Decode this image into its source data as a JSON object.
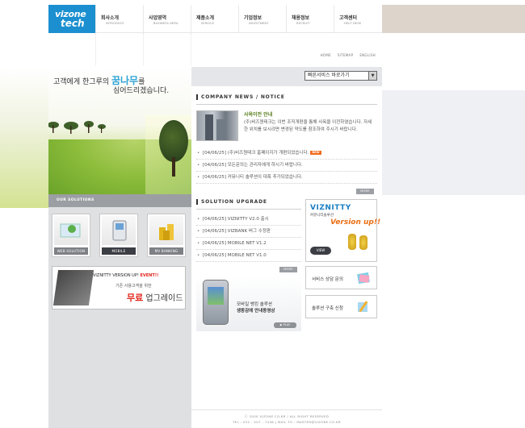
{
  "brand": {
    "line1": "vizone",
    "line2": "tech"
  },
  "nav": [
    {
      "ko": "회사소개",
      "en": "INTRODUCE"
    },
    {
      "ko": "사업영역",
      "en": "BUSINESS AREA"
    },
    {
      "ko": "제품소개",
      "en": "SERVICE"
    },
    {
      "ko": "기업정보",
      "en": "INVESTMENT"
    },
    {
      "ko": "채용정보",
      "en": "RECRUIT"
    },
    {
      "ko": "고객센터",
      "en": "HELP DESK"
    }
  ],
  "util": {
    "home": "HOME",
    "sitemap": "SITEMAP",
    "english": "ENGLISH"
  },
  "visual": {
    "slogan_pre": "고객에게 한그루의 ",
    "slogan_accent": "꿈나무",
    "slogan_post": "를",
    "slogan2": "심어드리겠습니다."
  },
  "solutions": {
    "title": "OUR SOLUTIONS",
    "items": [
      {
        "label": "WEB SOLUTION"
      },
      {
        "label": "MOBILE"
      },
      {
        "label": "MV BANKING"
      }
    ]
  },
  "event": {
    "line1_pre": "VIZNITTY VERSION UP! ",
    "line1_accent": "EVENT!!",
    "line2": "기존 사용고객을 위한",
    "line3_accent": "무료",
    "line3_post": " 업그레이드"
  },
  "quick": {
    "label": "빠른서비스 바로가기",
    "arrow": "▼"
  },
  "news": {
    "title": "COMPANY NEWS / NOTICE",
    "headline": "사옥이전 안내",
    "body": "(주)비즈원테크는 이번 조직개편을 통해 사옥을 이전하였습니다. 자세한 위치를 보시려면 변경된 약도를 참조하여 주시기 바랍니다.",
    "items": [
      {
        "text": "[04/06/25] (주)비즈원테크 홈페이지가 개편되었습니다.",
        "badge": "NEW"
      },
      {
        "text": "[04/06/25] 모든문의는 관리자에게 하시기 바랍니다."
      },
      {
        "text": "[04/06/25] 커뮤니티 솔루션이 대폭 추가되었습니다."
      }
    ],
    "more": "MORE"
  },
  "upgrade": {
    "title": "SOLUTION UPGRADE",
    "items": [
      {
        "text": "[04/06/25] VIZNITTY V2.0 출시"
      },
      {
        "text": "[04/06/25] VIZBANK 버그 수정판"
      },
      {
        "text": "[04/06/25] MOBILE NET V1.2"
      },
      {
        "text": "[04/06/25] MOBILE NET V1.0"
      }
    ],
    "more": "MORE"
  },
  "pda": {
    "line1": "모바일 뱅킹 솔루션",
    "line2": "생동감에 안내동영상",
    "play": "▶ PLAY"
  },
  "viz": {
    "logo": "VIZNITTY",
    "sub": "커뮤니티솔루션",
    "up": "Version up!!",
    "view": "VIEW"
  },
  "side": {
    "consult": "서비스 상담 문의",
    "apply": "솔루션 구축 신청"
  },
  "footer": {
    "line1": "ⓒ 2000 VIZONE.CO.KR / ALL RIGHT RESERVED",
    "line2": "TEL : 032 - 507 - 7436 | MAIL TO : MASTER@VIZONE.CO.KR"
  },
  "colors": {
    "brand_blue": "#1b8fd0",
    "green": "#8fbd3a",
    "panel_gray": "#dfe0e2",
    "orange": "#e96d14"
  }
}
